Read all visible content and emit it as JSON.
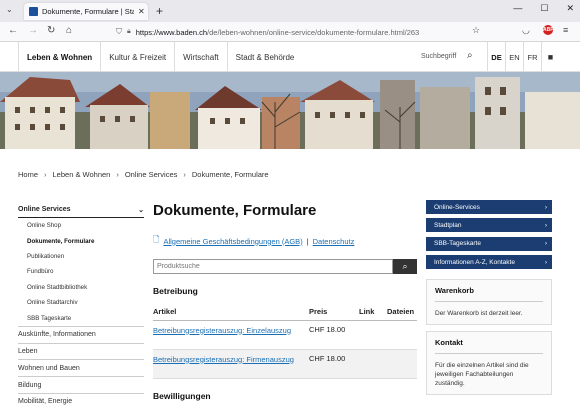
{
  "browser": {
    "tab_title": "Dokumente, Formulare | Stadt Baden",
    "new_tab": "+",
    "url_host": "https://www.baden.ch",
    "url_path": "/de/leben-wohnen/online-service/dokumente-formulare.html/263"
  },
  "site": {
    "menu": [
      "Leben & Wohnen",
      "Kultur & Freizeit",
      "Wirtschaft",
      "Stadt & Behörde"
    ],
    "search_label": "Suchbegriff",
    "languages": [
      "DE",
      "EN",
      "FR"
    ]
  },
  "breadcrumb": [
    "Home",
    "Leben & Wohnen",
    "Online Services",
    "Dokumente, Formulare"
  ],
  "leftnav": {
    "section": "Online Services",
    "subitems": [
      "Online Shop",
      "Dokumente, Formulare",
      "Publikationen",
      "Fundbüro",
      "Online Stadtbibliothek",
      "Online Stadtarchiv",
      "SBB Tageskarte"
    ],
    "items": [
      "Auskünfte, Informationen",
      "Leben",
      "Wohnen und Bauen",
      "Bildung",
      "Mobilität, Energie"
    ]
  },
  "main": {
    "title": "Dokumente, Formulare",
    "agb_link": "Allgemeine Geschäftsbedingungen (AGB)",
    "separator": "|",
    "privacy_link": "Datenschutz",
    "search_placeholder": "Produktsuche",
    "section1": "Betreibung",
    "columns": [
      "Artikel",
      "Preis",
      "Link",
      "Dateien"
    ],
    "rows": [
      {
        "article": "Betreibungsregisterauszug: Einzelauszug",
        "price": "CHF 18.00",
        "link": "",
        "files": ""
      },
      {
        "article": "Betreibungsregisterauszug: Firmenauszug",
        "price": "CHF 18.00",
        "link": "",
        "files": ""
      }
    ],
    "section2": "Bewilligungen"
  },
  "right": {
    "buttons": [
      "Online-Services",
      "Stadtplan",
      "SBB-Tageskarte",
      "Informationen A-Z, Kontakte"
    ],
    "cart_title": "Warenkorb",
    "cart_text": "Der Warenkorb ist derzeit leer.",
    "contact_title": "Kontakt",
    "contact_text": "Für die einzelnen Artikel sind die jeweiligen Fachabteilungen zuständig."
  },
  "colors": {
    "brand": "#1b3d72",
    "link": "#1a6fb5",
    "hero_sky": "#8aa0b8"
  }
}
